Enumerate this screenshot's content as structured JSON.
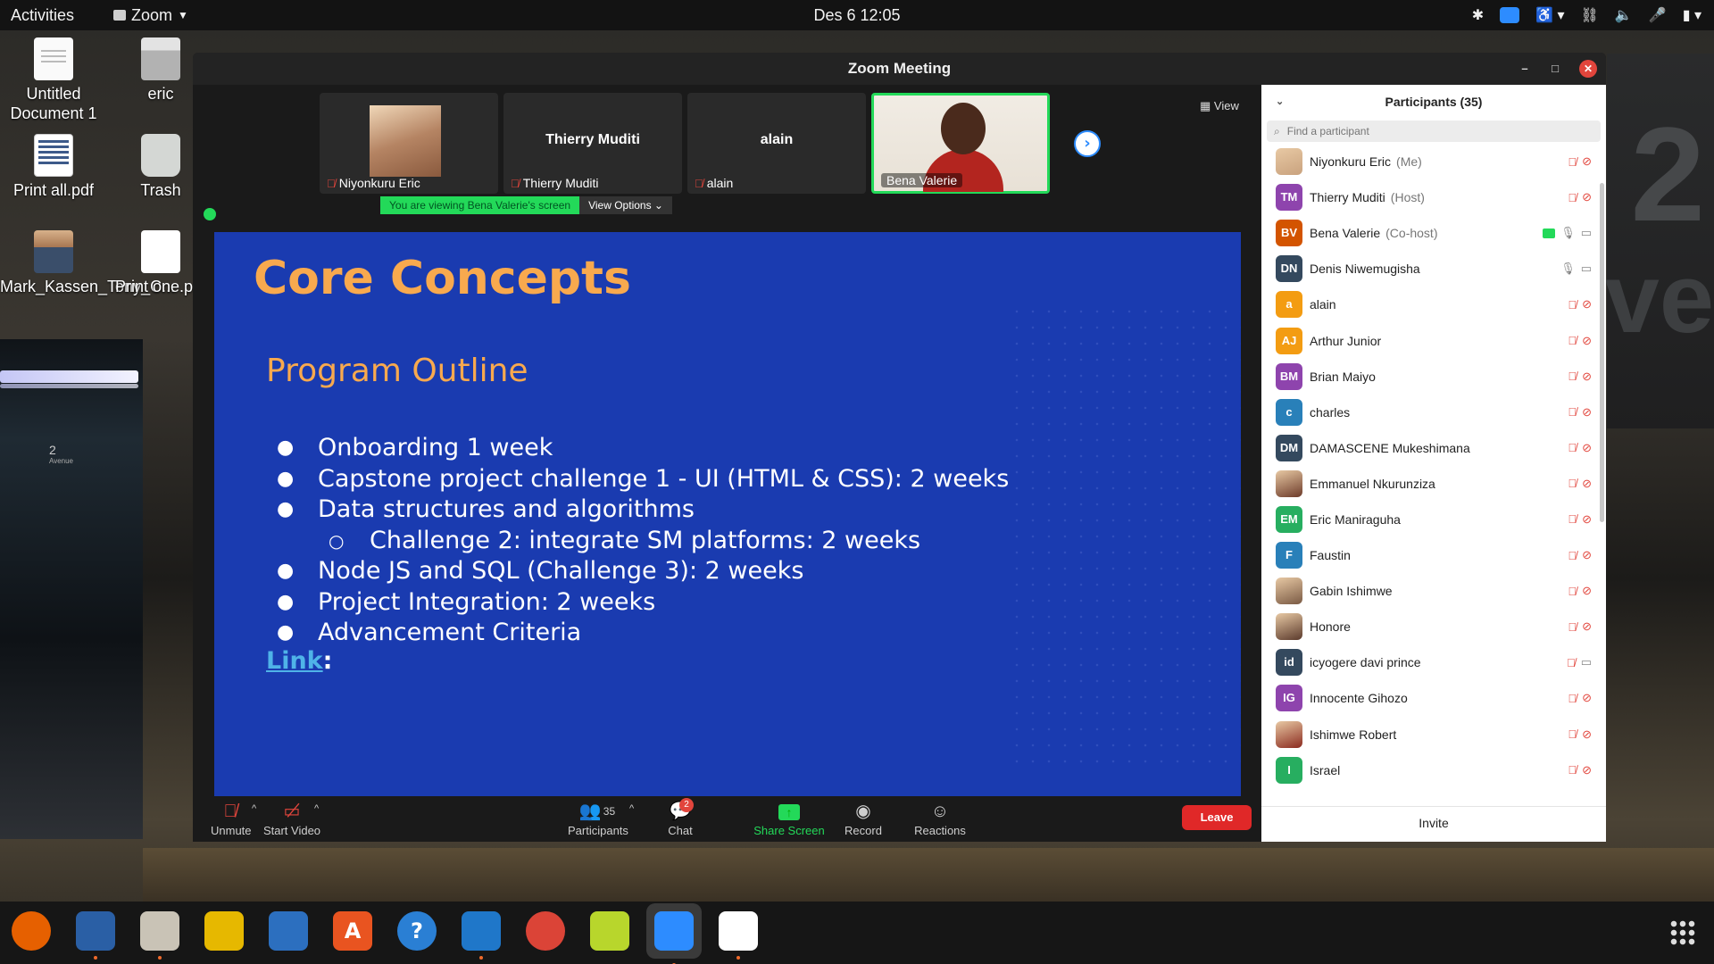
{
  "topbar": {
    "activities": "Activities",
    "app_name": "Zoom",
    "clock": "Des 6  12:05"
  },
  "desktop": {
    "icons": [
      {
        "label": "Untitled Document 1",
        "icon": "document-icon"
      },
      {
        "label": "eric",
        "icon": "home-folder-icon"
      },
      {
        "label": "Print all.pdf",
        "icon": "pdf-icon"
      },
      {
        "label": "Trash",
        "icon": "trash-icon"
      },
      {
        "label": "Mark_Kassen_Tony_C...",
        "icon": "photo-icon"
      },
      {
        "label": "Print one.pdf",
        "icon": "pdf-icon"
      }
    ]
  },
  "wallpaper": {
    "sign1": "2",
    "sign2": "Ave",
    "sign3": "2",
    "sign4": "Avenue"
  },
  "zoom": {
    "window_title": "Zoom Meeting",
    "view_label": "View",
    "strip": [
      {
        "name": "Niyonkuru Eric",
        "muted": true,
        "has_photo": true
      },
      {
        "name": "Thierry Muditi",
        "center": "Thierry Muditi",
        "muted": true
      },
      {
        "name": "alain",
        "center": "alain",
        "muted": true
      },
      {
        "name": "Bena Valerie",
        "muted": false,
        "active": true
      }
    ],
    "banner": {
      "viewing": "You are viewing Bena Valerie's screen",
      "options": "View Options"
    },
    "slide": {
      "title": "Core Concepts",
      "subtitle": "Program Outline",
      "items": [
        {
          "text": "Onboarding 1 week",
          "level": 1
        },
        {
          "text": "Capstone project challenge 1 - UI (HTML & CSS): 2 weeks",
          "level": 1
        },
        {
          "text": "Data structures and algorithms",
          "level": 1
        },
        {
          "text": "Challenge 2: integrate SM platforms: 2 weeks",
          "level": 2
        },
        {
          "text": "Node JS and SQL (Challenge 3): 2 weeks",
          "level": 1
        },
        {
          "text": "Project Integration: 2 weeks",
          "level": 1
        },
        {
          "text": "Advancement Criteria",
          "level": 1
        }
      ],
      "link_label": "Link",
      "link_suffix": ":"
    },
    "toolbar": {
      "unmute": "Unmute",
      "start_video": "Start Video",
      "participants": "Participants",
      "participants_count": "35",
      "chat": "Chat",
      "chat_badge": "2",
      "share_screen": "Share Screen",
      "record": "Record",
      "reactions": "Reactions",
      "leave": "Leave"
    },
    "panel": {
      "title": "Participants (35)",
      "search_placeholder": "Find a participant",
      "invite": "Invite",
      "participants": [
        {
          "initials": "",
          "photo": true,
          "name": "Niyonkuru Eric",
          "role": "(Me)",
          "color": "#c9a27e",
          "mic": "off",
          "cam": "off"
        },
        {
          "initials": "TM",
          "name": "Thierry Muditi",
          "role": "(Host)",
          "color": "#8e44ad",
          "mic": "off",
          "cam": "off"
        },
        {
          "initials": "BV",
          "name": "Bena Valerie",
          "role": "(Co-host)",
          "color": "#d35400",
          "mic": "on",
          "cam": "on",
          "sharing": true
        },
        {
          "initials": "DN",
          "name": "Denis Niwemugisha",
          "role": "",
          "color": "#34495e",
          "mic": "on",
          "cam": "on"
        },
        {
          "initials": "a",
          "name": "alain",
          "role": "",
          "color": "#f39c12",
          "mic": "off",
          "cam": "off"
        },
        {
          "initials": "AJ",
          "name": "Arthur Junior",
          "role": "",
          "color": "#f39c12",
          "mic": "off",
          "cam": "off"
        },
        {
          "initials": "BM",
          "name": "Brian Maiyo",
          "role": "",
          "color": "#8e44ad",
          "mic": "off",
          "cam": "off"
        },
        {
          "initials": "c",
          "name": "charles",
          "role": "",
          "color": "#2980b9",
          "mic": "off",
          "cam": "off"
        },
        {
          "initials": "DM",
          "name": "DAMASCENE Mukeshimana",
          "role": "",
          "color": "#34495e",
          "mic": "off",
          "cam": "off"
        },
        {
          "initials": "",
          "photo": true,
          "name": "Emmanuel Nkurunziza",
          "role": "",
          "color": "#6d3b2a",
          "mic": "off",
          "cam": "off"
        },
        {
          "initials": "EM",
          "name": "Eric Maniraguha",
          "role": "",
          "color": "#27ae60",
          "mic": "off",
          "cam": "off"
        },
        {
          "initials": "F",
          "name": "Faustin",
          "role": "",
          "color": "#2980b9",
          "mic": "off",
          "cam": "off"
        },
        {
          "initials": "",
          "photo": true,
          "name": "Gabin Ishimwe",
          "role": "",
          "color": "#7a5a44",
          "mic": "off",
          "cam": "off"
        },
        {
          "initials": "",
          "photo": true,
          "name": "Honore",
          "role": "",
          "color": "#5b3a2c",
          "mic": "off",
          "cam": "off"
        },
        {
          "initials": "id",
          "name": "icyogere davi prince",
          "role": "",
          "color": "#34495e",
          "mic": "off",
          "cam": "on"
        },
        {
          "initials": "IG",
          "name": "Innocente Gihozo",
          "role": "",
          "color": "#8e44ad",
          "mic": "off",
          "cam": "off"
        },
        {
          "initials": "",
          "photo": true,
          "name": "Ishimwe Robert",
          "role": "",
          "color": "#8b2a1f",
          "mic": "off",
          "cam": "off"
        },
        {
          "initials": "I",
          "name": "Israel",
          "role": "",
          "color": "#27ae60",
          "mic": "off",
          "cam": "off"
        }
      ]
    }
  },
  "dock": {
    "apps": [
      {
        "name": "firefox-icon",
        "color": "#e66000",
        "glyph": "",
        "running": false
      },
      {
        "name": "thunderbird-icon",
        "color": "#2a5fa5",
        "glyph": "",
        "running": true
      },
      {
        "name": "files-icon",
        "color": "#c9c3b6",
        "glyph": "",
        "running": true
      },
      {
        "name": "rhythmbox-icon",
        "color": "#e6b800",
        "glyph": "",
        "running": false
      },
      {
        "name": "writer-icon",
        "color": "#2c6fbf",
        "glyph": "",
        "running": false
      },
      {
        "name": "software-center-icon",
        "color": "#e95420",
        "glyph": "A",
        "running": false
      },
      {
        "name": "help-icon",
        "color": "#2a7fd4",
        "glyph": "?",
        "running": false
      },
      {
        "name": "vscode-icon",
        "color": "#1f77c9",
        "glyph": "",
        "running": true
      },
      {
        "name": "chrome-icon",
        "color": "#db4437",
        "glyph": "",
        "running": false
      },
      {
        "name": "notes-icon",
        "color": "#b8d62c",
        "glyph": "",
        "running": false
      },
      {
        "name": "zoom-icon",
        "color": "#2d8cff",
        "glyph": "",
        "running": true
      },
      {
        "name": "slack-icon",
        "color": "#ffffff",
        "glyph": "",
        "running": true
      }
    ]
  }
}
